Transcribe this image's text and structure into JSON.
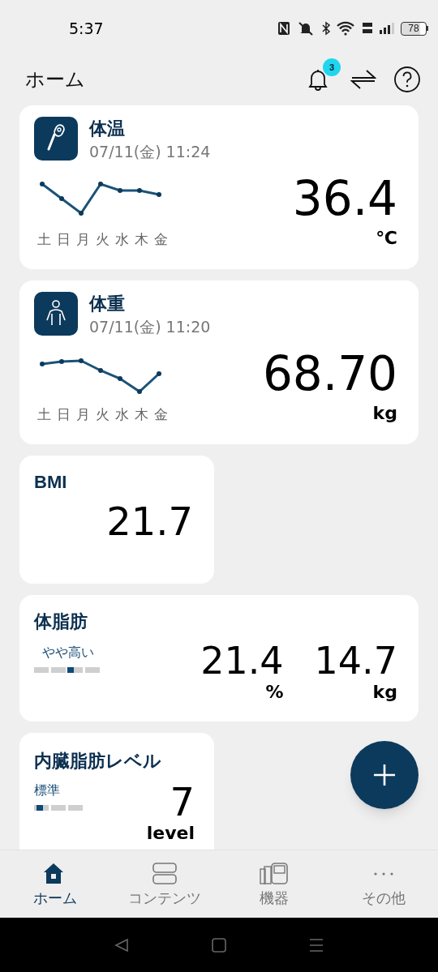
{
  "status_bar": {
    "time": "5:37",
    "battery": "78"
  },
  "header": {
    "title": "ホーム",
    "notification_count": "3"
  },
  "cards": [
    {
      "kind": "temperature",
      "title": "体温",
      "timestamp": "07/11(金) 11:24",
      "days": [
        "土",
        "日",
        "月",
        "火",
        "水",
        "木",
        "金"
      ],
      "value": "36.4",
      "unit": "℃"
    },
    {
      "kind": "weight",
      "title": "体重",
      "timestamp": "07/11(金) 11:20",
      "days": [
        "土",
        "日",
        "月",
        "火",
        "水",
        "木",
        "金"
      ],
      "value": "68.70",
      "unit": "kg"
    },
    {
      "kind": "bmi",
      "title": "BMI",
      "value": "21.7"
    },
    {
      "kind": "body_fat",
      "title": "体脂肪",
      "rating": "やや高い",
      "level": 0.56,
      "values": [
        {
          "value": "21.4",
          "unit": "%"
        },
        {
          "value": "14.7",
          "unit": "kg"
        }
      ]
    },
    {
      "kind": "visceral_fat",
      "title": "内臓脂肪レベル",
      "rating": "標準",
      "level": 0.12,
      "value": "7",
      "unit": "level"
    }
  ],
  "nav": [
    {
      "label": "ホーム",
      "kind": "home",
      "selected": true
    },
    {
      "label": "コンテンツ",
      "kind": "contents",
      "selected": false
    },
    {
      "label": "機器",
      "kind": "devices",
      "selected": false
    },
    {
      "label": "その他",
      "kind": "more",
      "selected": false
    }
  ]
}
